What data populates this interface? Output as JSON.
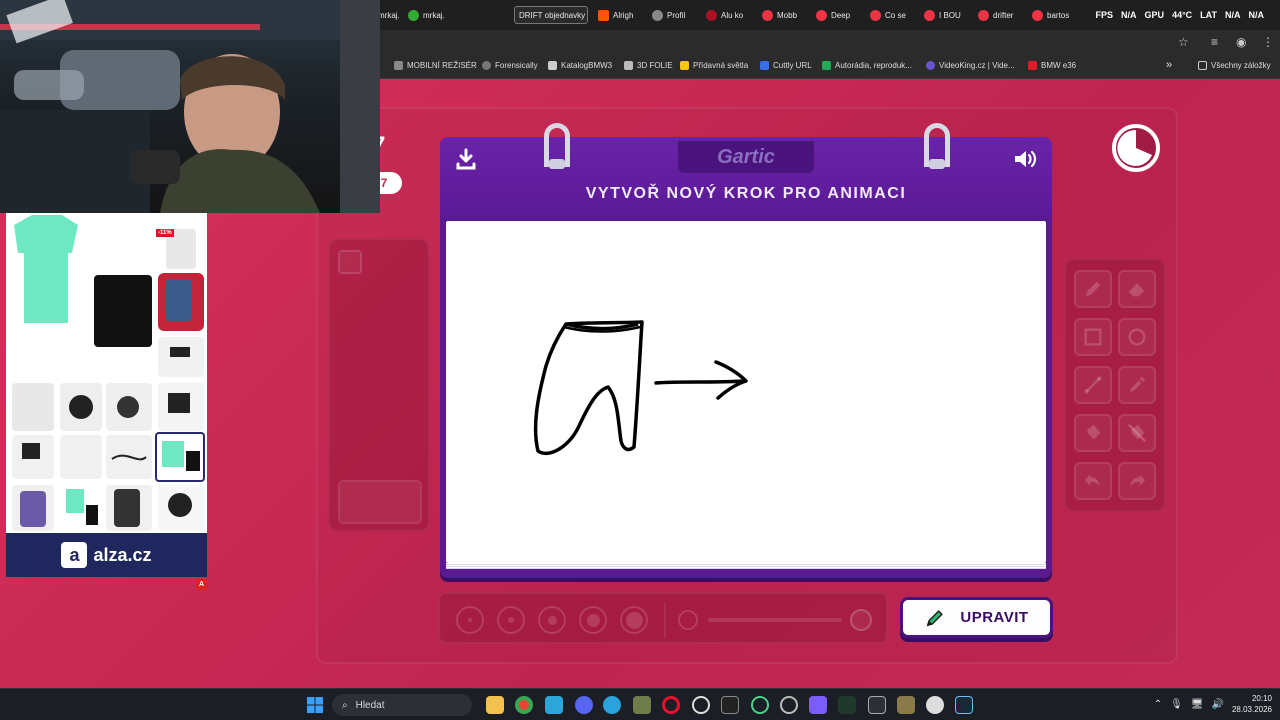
{
  "browser": {
    "tabs": [
      {
        "label": "mrkaj.",
        "color": "#33aa33"
      },
      {
        "label": "mrkaj.",
        "color": "#33aa33"
      },
      {
        "label": "DRIFT objednavky",
        "color": "#ffffff",
        "boxed": true
      },
      {
        "label": "Alrigh",
        "color": "#ff5500"
      },
      {
        "label": "Profil",
        "color": "#888888"
      },
      {
        "label": "Alu ko",
        "color": "#aa1122"
      },
      {
        "label": "Mobb",
        "color": "#ee3344"
      },
      {
        "label": "Deep",
        "color": "#ee3344"
      },
      {
        "label": "Co se",
        "color": "#ee3344"
      },
      {
        "label": "I BOU",
        "color": "#ee3344"
      },
      {
        "label": "drifter",
        "color": "#ee3344"
      },
      {
        "label": "bartos",
        "color": "#ee3344"
      }
    ],
    "hud": {
      "fps_label": "FPS",
      "fps_value": "N/A",
      "gpu_label": "GPU",
      "gpu_temp": "44°C",
      "lat_label": "LAT",
      "lat_value1": "N/A",
      "lat_value2": "N/A"
    },
    "bookmarks": [
      {
        "label": "MOBILNÍ REŽISÉR",
        "color": "#888888"
      },
      {
        "label": "Forensically",
        "color": "#777777"
      },
      {
        "label": "KatalogBMW3",
        "color": "#cccccc"
      },
      {
        "label": "3D FOLIE",
        "color": "#bbbbbb"
      },
      {
        "label": "Přídavná světla",
        "color": "#f5c518"
      },
      {
        "label": "Cuttly URL",
        "color": "#3a6ee8"
      },
      {
        "label": "Autorádia, reproduk...",
        "color": "#22aa55"
      },
      {
        "label": "VideoKing.cz | Vide...",
        "color": "#6655cc"
      },
      {
        "label": "BMW e36",
        "color": "#e21b2b"
      }
    ],
    "bookmarks_more": "»",
    "all_bookmarks": "Všechny záložky"
  },
  "game": {
    "logo": "Gartic",
    "title": "VYTVOŘ NOVÝ KROK PRO ANIMACI",
    "edit_button": "UPRAVIT",
    "partial_number": "7",
    "partial_pill": "7",
    "colors": {
      "board": "#5b1a8f",
      "background": "#c4284e",
      "button_border": "#4a137e"
    },
    "icons": [
      "download-icon",
      "speaker-icon",
      "pencil-icon",
      "eraser-icon",
      "square-icon",
      "circle-icon",
      "line-icon",
      "eyedropper-icon",
      "fill-icon",
      "fill-off-icon",
      "undo-icon",
      "redo-icon"
    ]
  },
  "ad": {
    "brand": "alza.cz",
    "sale": "-11%",
    "badge": "A"
  },
  "taskbar": {
    "search_placeholder": "Hledat",
    "time": "20:10",
    "date": "28.03.2026"
  }
}
